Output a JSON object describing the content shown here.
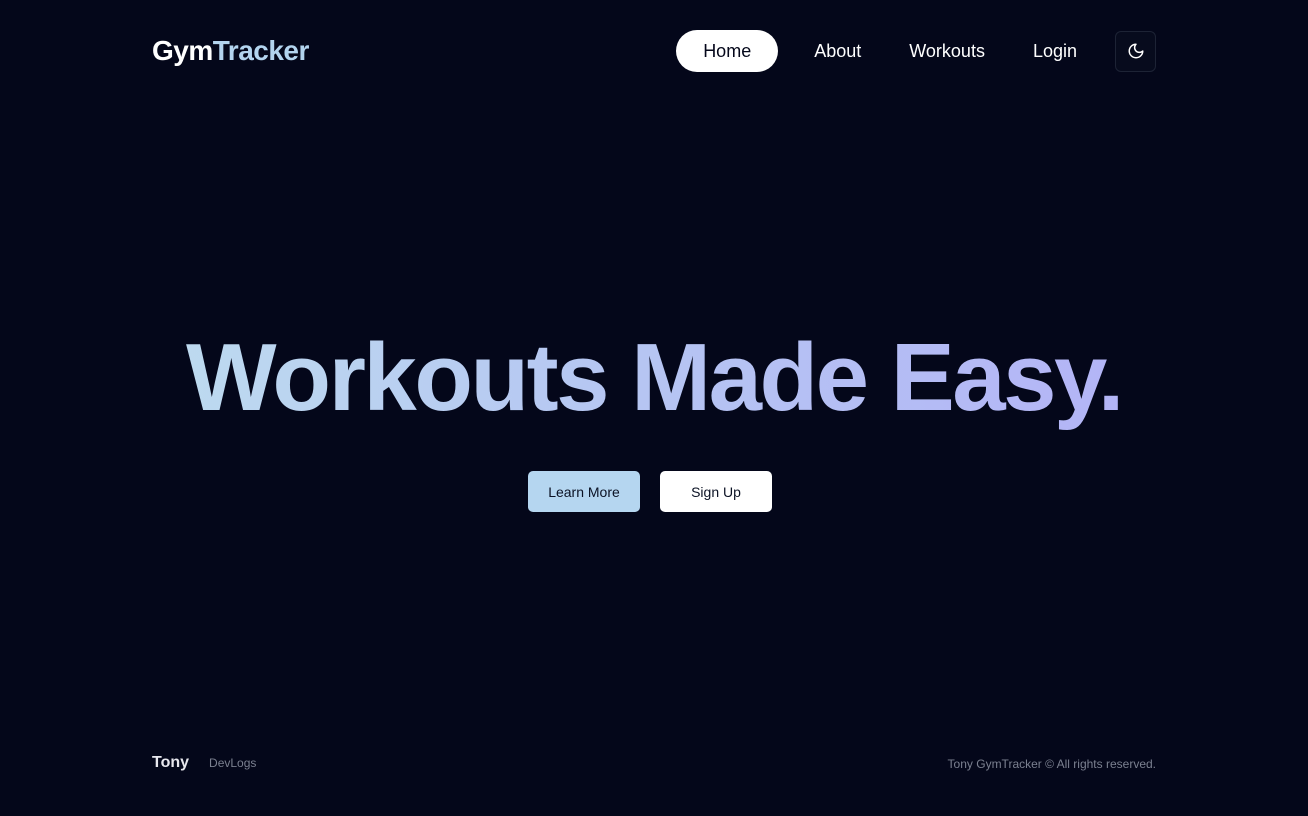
{
  "header": {
    "logo_part1": "Gym",
    "logo_part2": "Tracker",
    "nav": {
      "home": "Home",
      "about": "About",
      "workouts": "Workouts",
      "login": "Login"
    },
    "theme_icon": "moon-icon"
  },
  "hero": {
    "title": "Workouts Made Easy.",
    "learn_more": "Learn More",
    "sign_up": "Sign Up"
  },
  "footer": {
    "brand": "Tony",
    "link": "DevLogs",
    "copyright": "Tony GymTracker © All rights reserved."
  },
  "colors": {
    "background": "#04071a",
    "accent": "#b5d6f0",
    "gradient_start": "#c0e2ee",
    "gradient_end": "#b2aef8"
  }
}
